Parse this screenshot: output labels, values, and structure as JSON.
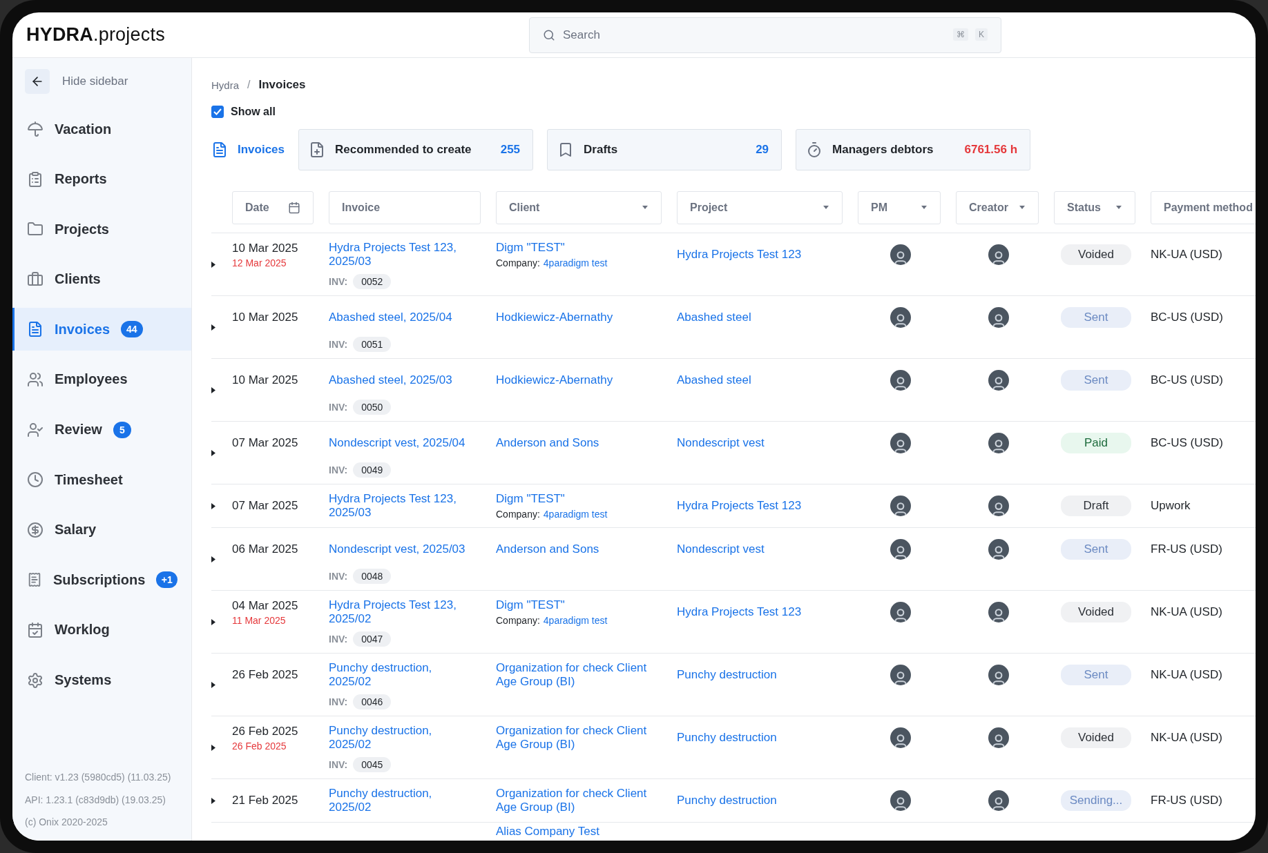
{
  "app": {
    "logo_bold": "HYDRA",
    "logo_rest": ".projects"
  },
  "search": {
    "placeholder": "Search",
    "keys": [
      "⌘",
      "K"
    ]
  },
  "sidebar": {
    "hide_label": "Hide sidebar",
    "items": [
      {
        "label": "Vacation",
        "selected": false
      },
      {
        "label": "Reports",
        "selected": false
      },
      {
        "label": "Projects",
        "selected": false
      },
      {
        "label": "Clients",
        "selected": false
      },
      {
        "label": "Invoices",
        "selected": true,
        "badge": "44"
      },
      {
        "label": "Employees",
        "selected": false
      },
      {
        "label": "Review",
        "selected": false,
        "badge": "5"
      },
      {
        "label": "Timesheet",
        "selected": false
      },
      {
        "label": "Salary",
        "selected": false
      },
      {
        "label": "Subscriptions",
        "selected": false,
        "badge": "+1"
      },
      {
        "label": "Worklog",
        "selected": false
      },
      {
        "label": "Systems",
        "selected": false
      }
    ],
    "footer": [
      "Client: v1.23 (5980cd5) (11.03.25)",
      "API: 1.23.1 (c83d9db) (19.03.25)",
      "(c) Onix 2020-2025"
    ]
  },
  "breadcrumb": {
    "items": [
      "Hydra",
      "Invoices"
    ],
    "separator": "/"
  },
  "show_all": {
    "label": "Show all",
    "checked": true
  },
  "tabs": [
    {
      "label": "Invoices",
      "selected": true
    },
    {
      "label": "Recommended to create",
      "count": "255",
      "selected": false,
      "alert": false
    },
    {
      "label": "Drafts",
      "count": "29",
      "selected": false,
      "alert": false
    },
    {
      "label": "Managers debtors",
      "count": "6761.56 h",
      "selected": false,
      "alert": true
    }
  ],
  "table": {
    "columns": [
      {
        "label": "Date",
        "kind": "date"
      },
      {
        "label": "Invoice",
        "kind": "text"
      },
      {
        "label": "Client",
        "kind": "select"
      },
      {
        "label": "Project",
        "kind": "select"
      },
      {
        "label": "PM",
        "kind": "select"
      },
      {
        "label": "Creator",
        "kind": "select"
      },
      {
        "label": "Status",
        "kind": "select"
      },
      {
        "label": "Payment method",
        "kind": "text"
      }
    ],
    "rows": [
      {
        "date": "10 Mar 2025",
        "due": "12 Mar 2025",
        "invoice": "Hydra Projects Test 123, 2025/03",
        "inv_label": "INV:",
        "number": "0052",
        "client": "Digm \"TEST\"",
        "company_label": "Company:",
        "company": "4paradigm test",
        "project": "Hydra Projects Test 123",
        "status": {
          "label": "Voided",
          "kind": "neutral"
        },
        "payment": "NK-UA (USD)"
      },
      {
        "date": "10 Mar 2025",
        "invoice": "Abashed steel, 2025/04",
        "inv_label": "INV:",
        "number": "0051",
        "client": "Hodkiewicz-Abernathy",
        "project": "Abashed steel",
        "status": {
          "label": "Sent",
          "kind": "info"
        },
        "payment": "BC-US (USD)"
      },
      {
        "date": "10 Mar 2025",
        "invoice": "Abashed steel, 2025/03",
        "inv_label": "INV:",
        "number": "0050",
        "client": "Hodkiewicz-Abernathy",
        "project": "Abashed steel",
        "status": {
          "label": "Sent",
          "kind": "info"
        },
        "payment": "BC-US (USD)"
      },
      {
        "date": "07 Mar 2025",
        "invoice": "Nondescript vest, 2025/04",
        "inv_label": "INV:",
        "number": "0049",
        "client": "Anderson and Sons",
        "project": "Nondescript vest",
        "status": {
          "label": "Paid",
          "kind": "success"
        },
        "payment": "BC-US (USD)"
      },
      {
        "date": "07 Mar 2025",
        "invoice": "Hydra Projects Test 123, 2025/03",
        "client": "Digm \"TEST\"",
        "company_label": "Company:",
        "company": "4paradigm test",
        "project": "Hydra Projects Test 123",
        "status": {
          "label": "Draft",
          "kind": "neutral"
        },
        "payment": "Upwork"
      },
      {
        "date": "06 Mar 2025",
        "invoice": "Nondescript vest, 2025/03",
        "inv_label": "INV:",
        "number": "0048",
        "client": "Anderson and Sons",
        "project": "Nondescript vest",
        "status": {
          "label": "Sent",
          "kind": "info"
        },
        "payment": "FR-US (USD)"
      },
      {
        "date": "04 Mar 2025",
        "due": "11 Mar 2025",
        "invoice": "Hydra Projects Test 123, 2025/02",
        "inv_label": "INV:",
        "number": "0047",
        "client": "Digm \"TEST\"",
        "company_label": "Company:",
        "company": "4paradigm test",
        "project": "Hydra Projects Test 123",
        "status": {
          "label": "Voided",
          "kind": "neutral"
        },
        "payment": "NK-UA (USD)"
      },
      {
        "date": "26 Feb 2025",
        "invoice": "Punchy destruction, 2025/02",
        "inv_label": "INV:",
        "number": "0046",
        "client": "Organization for check Client Age Group (BI)",
        "project": "Punchy destruction",
        "status": {
          "label": "Sent",
          "kind": "info"
        },
        "payment": "NK-UA (USD)"
      },
      {
        "date": "26 Feb 2025",
        "due": "26 Feb 2025",
        "invoice": "Punchy destruction, 2025/02",
        "inv_label": "INV:",
        "number": "0045",
        "client": "Organization for check Client Age Group (BI)",
        "project": "Punchy destruction",
        "status": {
          "label": "Voided",
          "kind": "neutral"
        },
        "payment": "NK-UA (USD)"
      },
      {
        "date": "21 Feb 2025",
        "invoice": "Punchy destruction, 2025/02",
        "client": "Organization for check Client Age Group (BI)",
        "project": "Punchy destruction",
        "status": {
          "label": "Sending...",
          "kind": "info"
        },
        "payment": "FR-US (USD)"
      },
      {
        "client": "Alias Company Test"
      }
    ]
  }
}
